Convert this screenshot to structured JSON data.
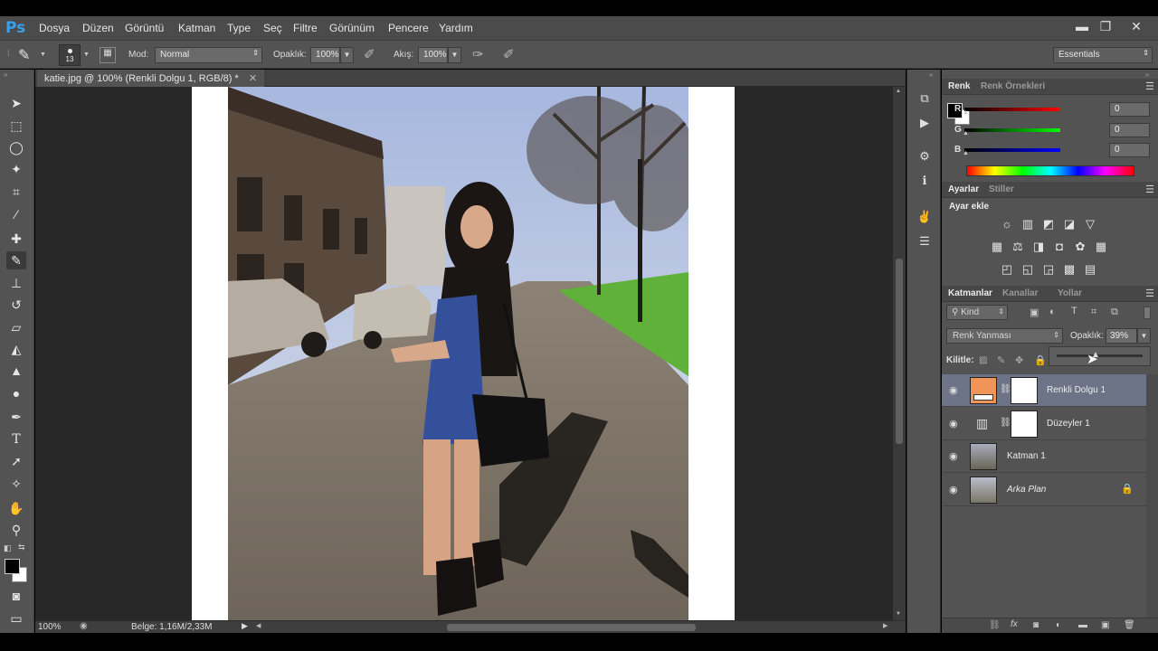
{
  "app": {
    "logo": "Ps"
  },
  "menu": [
    "Dosya",
    "Düzen",
    "Görüntü",
    "Katman",
    "Type",
    "Seç",
    "Filtre",
    "Görünüm",
    "Pencere",
    "Yardım"
  ],
  "window_controls": {
    "minimize": "▬",
    "restore": "❐",
    "close": "✕"
  },
  "options": {
    "brush_size": "13",
    "mode_label": "Mod:",
    "mode_value": "Normal",
    "opacity_label": "Opaklık:",
    "opacity_value": "100%",
    "flow_label": "Akış:",
    "flow_value": "100%",
    "workspace": "Essentials"
  },
  "document": {
    "tab_title": "katie.jpg @ 100% (Renkli Dolgu 1, RGB/8) *",
    "zoom": "100%",
    "doc_info": "Belge: 1,16M/2,33M"
  },
  "color_panel": {
    "tabs": [
      "Renk",
      "Renk Örnekleri"
    ],
    "channels": [
      {
        "label": "R",
        "value": "0"
      },
      {
        "label": "G",
        "value": "0"
      },
      {
        "label": "B",
        "value": "0"
      }
    ]
  },
  "adjustments_panel": {
    "tabs": [
      "Ayarlar",
      "Stiller"
    ],
    "heading": "Ayar ekle"
  },
  "layers_panel": {
    "tabs": [
      "Katmanlar",
      "Kanallar",
      "Yollar"
    ],
    "filter_kind": "Kind",
    "blend_mode": "Renk Yanması",
    "opacity_label": "Opaklık:",
    "opacity_value": "39%",
    "lock_label": "Kilitle:",
    "layers": [
      {
        "name": "Renkli Dolgu 1",
        "selected": true
      },
      {
        "name": "Düzeyler 1",
        "selected": false
      },
      {
        "name": "Katman 1",
        "selected": false
      },
      {
        "name": "Arka Plan",
        "selected": false,
        "locked": true
      }
    ]
  },
  "colors": {
    "fill_layer": "#f0955a",
    "selection": "#6d7487",
    "ps_blue": "#3a9ee8"
  },
  "icons": {
    "tools": [
      "move-icon",
      "marquee-icon",
      "lasso-icon",
      "quick-select-icon",
      "crop-icon",
      "eyedropper-icon",
      "healing-brush-icon",
      "brush-icon",
      "clone-stamp-icon",
      "history-brush-icon",
      "eraser-icon",
      "gradient-icon",
      "blur-icon",
      "dodge-icon",
      "pen-icon",
      "type-icon",
      "path-select-icon",
      "shape-icon",
      "hand-icon",
      "zoom-icon"
    ]
  }
}
